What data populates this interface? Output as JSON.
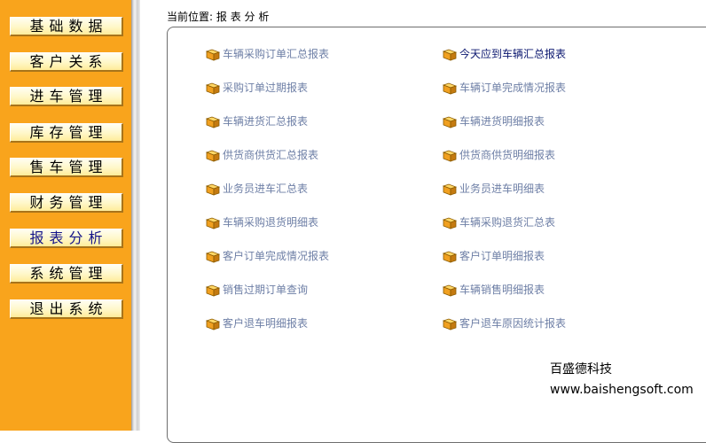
{
  "sidebar": {
    "items": [
      {
        "label": "基础数据",
        "active": false
      },
      {
        "label": "客户关系",
        "active": false
      },
      {
        "label": "进车管理",
        "active": false
      },
      {
        "label": "库存管理",
        "active": false
      },
      {
        "label": "售车管理",
        "active": false
      },
      {
        "label": "财务管理",
        "active": false
      },
      {
        "label": "报表分析",
        "active": true
      },
      {
        "label": "系统管理",
        "active": false
      },
      {
        "label": "退出系统",
        "active": false
      }
    ]
  },
  "breadcrumb": {
    "prefix": "当前位置:",
    "current": "报 表 分 析"
  },
  "reports": {
    "left": [
      {
        "label": "车辆采购订单汇总报表"
      },
      {
        "label": "采购订单过期报表"
      },
      {
        "label": "车辆进货汇总报表"
      },
      {
        "label": "供货商供货汇总报表"
      },
      {
        "label": "业务员进车汇总表"
      },
      {
        "label": "车辆采购退货明细表"
      },
      {
        "label": "客户订单完成情况报表"
      },
      {
        "label": "销售过期订单查询"
      },
      {
        "label": "客户退车明细报表"
      }
    ],
    "right": [
      {
        "label": "今天应到车辆汇总报表"
      },
      {
        "label": "车辆订单完成情况报表"
      },
      {
        "label": "车辆进货明细报表"
      },
      {
        "label": "供货商供货明细报表"
      },
      {
        "label": "业务员进车明细表"
      },
      {
        "label": "车辆采购退货汇总表"
      },
      {
        "label": "客户订单明细报表"
      },
      {
        "label": "车辆销售明细报表"
      },
      {
        "label": "客户退车原因统计报表"
      }
    ]
  },
  "footer": {
    "company": "百盛德科技",
    "url": "www.baishengsoft.com"
  },
  "colors": {
    "sidebar_bg": "#f9a41c",
    "link": "#6e7fa6",
    "link_highlight": "#0c1870"
  },
  "icons": {
    "report": "folder-icon"
  }
}
